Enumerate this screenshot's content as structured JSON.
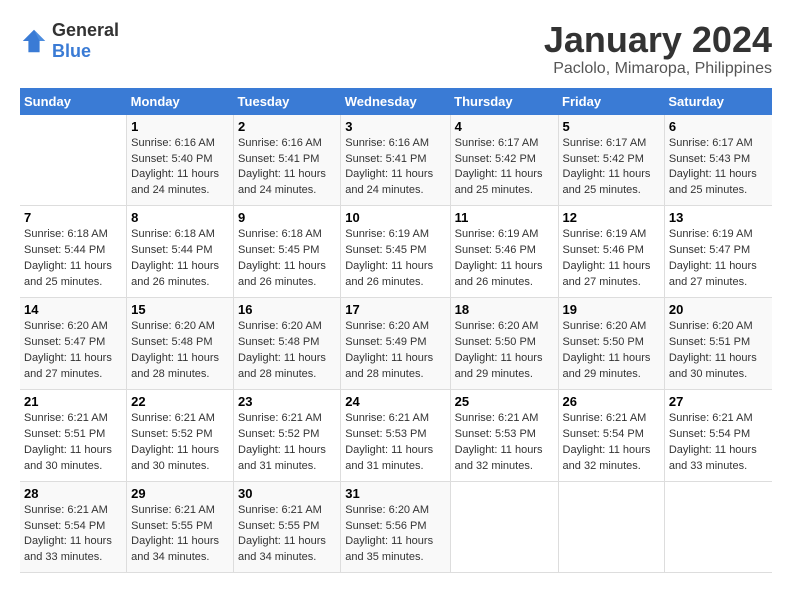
{
  "header": {
    "logo_general": "General",
    "logo_blue": "Blue",
    "month_title": "January 2024",
    "location": "Paclolo, Mimaropa, Philippines"
  },
  "calendar": {
    "days_of_week": [
      "Sunday",
      "Monday",
      "Tuesday",
      "Wednesday",
      "Thursday",
      "Friday",
      "Saturday"
    ],
    "weeks": [
      [
        {
          "day": "",
          "info": ""
        },
        {
          "day": "1",
          "info": "Sunrise: 6:16 AM\nSunset: 5:40 PM\nDaylight: 11 hours\nand 24 minutes."
        },
        {
          "day": "2",
          "info": "Sunrise: 6:16 AM\nSunset: 5:41 PM\nDaylight: 11 hours\nand 24 minutes."
        },
        {
          "day": "3",
          "info": "Sunrise: 6:16 AM\nSunset: 5:41 PM\nDaylight: 11 hours\nand 24 minutes."
        },
        {
          "day": "4",
          "info": "Sunrise: 6:17 AM\nSunset: 5:42 PM\nDaylight: 11 hours\nand 25 minutes."
        },
        {
          "day": "5",
          "info": "Sunrise: 6:17 AM\nSunset: 5:42 PM\nDaylight: 11 hours\nand 25 minutes."
        },
        {
          "day": "6",
          "info": "Sunrise: 6:17 AM\nSunset: 5:43 PM\nDaylight: 11 hours\nand 25 minutes."
        }
      ],
      [
        {
          "day": "7",
          "info": "Sunrise: 6:18 AM\nSunset: 5:44 PM\nDaylight: 11 hours\nand 25 minutes."
        },
        {
          "day": "8",
          "info": "Sunrise: 6:18 AM\nSunset: 5:44 PM\nDaylight: 11 hours\nand 26 minutes."
        },
        {
          "day": "9",
          "info": "Sunrise: 6:18 AM\nSunset: 5:45 PM\nDaylight: 11 hours\nand 26 minutes."
        },
        {
          "day": "10",
          "info": "Sunrise: 6:19 AM\nSunset: 5:45 PM\nDaylight: 11 hours\nand 26 minutes."
        },
        {
          "day": "11",
          "info": "Sunrise: 6:19 AM\nSunset: 5:46 PM\nDaylight: 11 hours\nand 26 minutes."
        },
        {
          "day": "12",
          "info": "Sunrise: 6:19 AM\nSunset: 5:46 PM\nDaylight: 11 hours\nand 27 minutes."
        },
        {
          "day": "13",
          "info": "Sunrise: 6:19 AM\nSunset: 5:47 PM\nDaylight: 11 hours\nand 27 minutes."
        }
      ],
      [
        {
          "day": "14",
          "info": "Sunrise: 6:20 AM\nSunset: 5:47 PM\nDaylight: 11 hours\nand 27 minutes."
        },
        {
          "day": "15",
          "info": "Sunrise: 6:20 AM\nSunset: 5:48 PM\nDaylight: 11 hours\nand 28 minutes."
        },
        {
          "day": "16",
          "info": "Sunrise: 6:20 AM\nSunset: 5:48 PM\nDaylight: 11 hours\nand 28 minutes."
        },
        {
          "day": "17",
          "info": "Sunrise: 6:20 AM\nSunset: 5:49 PM\nDaylight: 11 hours\nand 28 minutes."
        },
        {
          "day": "18",
          "info": "Sunrise: 6:20 AM\nSunset: 5:50 PM\nDaylight: 11 hours\nand 29 minutes."
        },
        {
          "day": "19",
          "info": "Sunrise: 6:20 AM\nSunset: 5:50 PM\nDaylight: 11 hours\nand 29 minutes."
        },
        {
          "day": "20",
          "info": "Sunrise: 6:20 AM\nSunset: 5:51 PM\nDaylight: 11 hours\nand 30 minutes."
        }
      ],
      [
        {
          "day": "21",
          "info": "Sunrise: 6:21 AM\nSunset: 5:51 PM\nDaylight: 11 hours\nand 30 minutes."
        },
        {
          "day": "22",
          "info": "Sunrise: 6:21 AM\nSunset: 5:52 PM\nDaylight: 11 hours\nand 30 minutes."
        },
        {
          "day": "23",
          "info": "Sunrise: 6:21 AM\nSunset: 5:52 PM\nDaylight: 11 hours\nand 31 minutes."
        },
        {
          "day": "24",
          "info": "Sunrise: 6:21 AM\nSunset: 5:53 PM\nDaylight: 11 hours\nand 31 minutes."
        },
        {
          "day": "25",
          "info": "Sunrise: 6:21 AM\nSunset: 5:53 PM\nDaylight: 11 hours\nand 32 minutes."
        },
        {
          "day": "26",
          "info": "Sunrise: 6:21 AM\nSunset: 5:54 PM\nDaylight: 11 hours\nand 32 minutes."
        },
        {
          "day": "27",
          "info": "Sunrise: 6:21 AM\nSunset: 5:54 PM\nDaylight: 11 hours\nand 33 minutes."
        }
      ],
      [
        {
          "day": "28",
          "info": "Sunrise: 6:21 AM\nSunset: 5:54 PM\nDaylight: 11 hours\nand 33 minutes."
        },
        {
          "day": "29",
          "info": "Sunrise: 6:21 AM\nSunset: 5:55 PM\nDaylight: 11 hours\nand 34 minutes."
        },
        {
          "day": "30",
          "info": "Sunrise: 6:21 AM\nSunset: 5:55 PM\nDaylight: 11 hours\nand 34 minutes."
        },
        {
          "day": "31",
          "info": "Sunrise: 6:20 AM\nSunset: 5:56 PM\nDaylight: 11 hours\nand 35 minutes."
        },
        {
          "day": "",
          "info": ""
        },
        {
          "day": "",
          "info": ""
        },
        {
          "day": "",
          "info": ""
        }
      ]
    ]
  }
}
